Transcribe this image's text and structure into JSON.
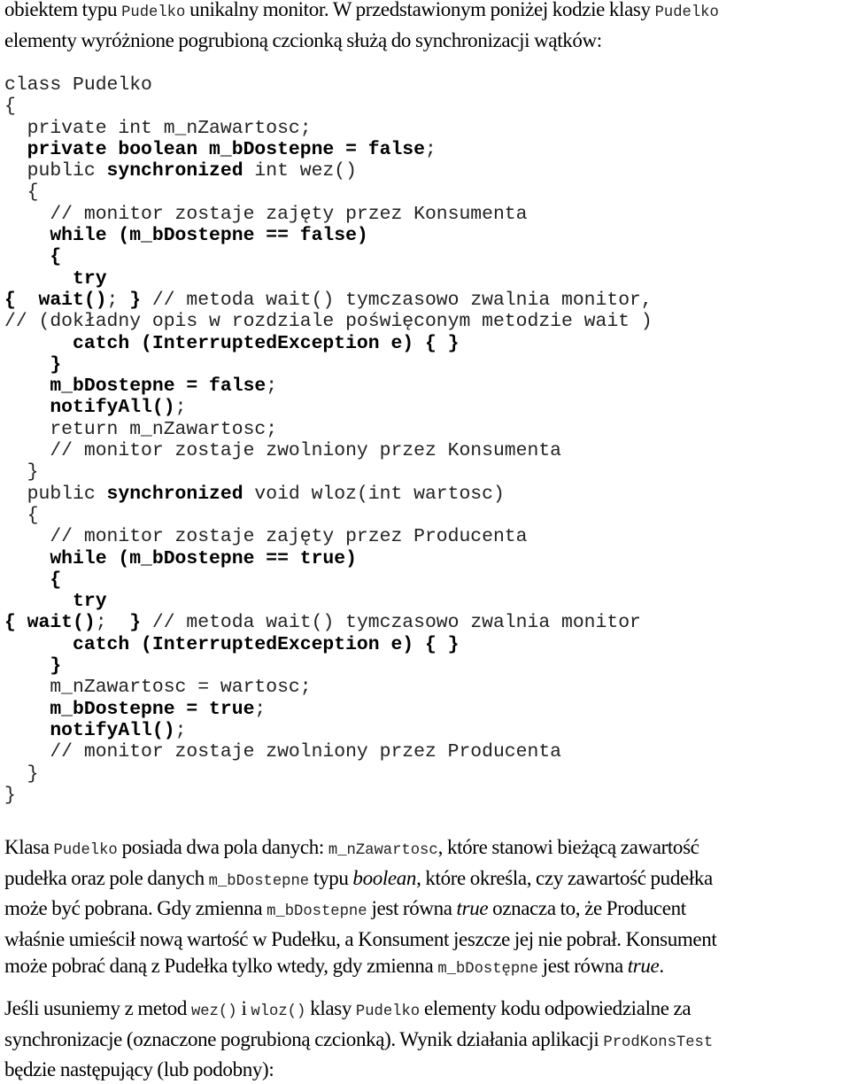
{
  "intro": {
    "line1": [
      {
        "t": "text",
        "v": "obiektem typu "
      },
      {
        "t": "code",
        "v": "Pudelko"
      },
      {
        "t": "text",
        "v": " unikalny monitor. W przedstawionym poniżej kodzie klasy "
      },
      {
        "t": "code",
        "v": "Pudelko"
      }
    ],
    "line2": [
      {
        "t": "text",
        "v": "elementy wyróżnione pogrubioną czcionką służą do synchronizacji wątków:"
      }
    ]
  },
  "code_lines": [
    [
      {
        "t": "n",
        "v": "class Pudelko"
      }
    ],
    [
      {
        "t": "n",
        "v": "{"
      }
    ],
    [
      {
        "t": "n",
        "v": "  private int m_nZawartosc;"
      }
    ],
    [
      {
        "t": "b",
        "v": "  private boolean m_bDostepne = false"
      },
      {
        "t": "n",
        "v": ";"
      }
    ],
    [
      {
        "t": "n",
        "v": "  public "
      },
      {
        "t": "b",
        "v": "synchronized"
      },
      {
        "t": "n",
        "v": " int wez()"
      }
    ],
    [
      {
        "t": "n",
        "v": "  {"
      }
    ],
    [
      {
        "t": "n",
        "v": "    // monitor zostaje zajęty przez Konsumenta"
      }
    ],
    [
      {
        "t": "b",
        "v": "    while (m_bDostepne == false)"
      }
    ],
    [
      {
        "t": "b",
        "v": "    {"
      }
    ],
    [
      {
        "t": "b",
        "v": "      try"
      }
    ],
    [
      {
        "t": "b",
        "v": "{  wait()"
      },
      {
        "t": "n",
        "v": "; "
      },
      {
        "t": "b",
        "v": "}"
      },
      {
        "t": "n",
        "v": " // metoda wait() tymczasowo zwalnia monitor,"
      }
    ],
    [
      {
        "t": "n",
        "v": "// (dokładny opis w rozdziale poświęconym metodzie wait )"
      }
    ],
    [
      {
        "t": "b",
        "v": "      catch (InterruptedException e) { }"
      }
    ],
    [
      {
        "t": "b",
        "v": "    }"
      }
    ],
    [
      {
        "t": "b",
        "v": "    m_bDostepne = false"
      },
      {
        "t": "n",
        "v": ";"
      }
    ],
    [
      {
        "t": "b",
        "v": "    notifyAll()"
      },
      {
        "t": "n",
        "v": ";"
      }
    ],
    [
      {
        "t": "n",
        "v": "    return m_nZawartosc;"
      }
    ],
    [
      {
        "t": "n",
        "v": "    // monitor zostaje zwolniony przez Konsumenta"
      }
    ],
    [
      {
        "t": "n",
        "v": "  }"
      }
    ],
    [
      {
        "t": "n",
        "v": "  public "
      },
      {
        "t": "b",
        "v": "synchronized"
      },
      {
        "t": "n",
        "v": " void wloz(int wartosc)"
      }
    ],
    [
      {
        "t": "n",
        "v": "  {"
      }
    ],
    [
      {
        "t": "n",
        "v": "    // monitor zostaje zajęty przez Producenta"
      }
    ],
    [
      {
        "t": "b",
        "v": "    while (m_bDostepne == true)"
      }
    ],
    [
      {
        "t": "b",
        "v": "    {"
      }
    ],
    [
      {
        "t": "b",
        "v": "      try"
      }
    ],
    [
      {
        "t": "b",
        "v": "{ wait()"
      },
      {
        "t": "n",
        "v": ";  "
      },
      {
        "t": "b",
        "v": "}"
      },
      {
        "t": "n",
        "v": " // metoda wait() tymczasowo zwalnia monitor"
      }
    ],
    [
      {
        "t": "b",
        "v": "      catch (InterruptedException e) { }"
      }
    ],
    [
      {
        "t": "b",
        "v": "    }"
      }
    ],
    [
      {
        "t": "n",
        "v": "    m_nZawartosc = wartosc;"
      }
    ],
    [
      {
        "t": "b",
        "v": "    m_bDostepne = true"
      },
      {
        "t": "n",
        "v": ";"
      }
    ],
    [
      {
        "t": "b",
        "v": "    notifyAll()"
      },
      {
        "t": "n",
        "v": ";"
      }
    ],
    [
      {
        "t": "n",
        "v": "    // monitor zostaje zwolniony przez Producenta"
      }
    ],
    [
      {
        "t": "n",
        "v": "  }"
      }
    ],
    [
      {
        "t": "n",
        "v": "}"
      }
    ]
  ],
  "para1": [
    [
      {
        "t": "text",
        "v": "Klasa "
      },
      {
        "t": "code",
        "v": "Pudelko"
      },
      {
        "t": "text",
        "v": " posiada dwa pola danych: "
      },
      {
        "t": "code",
        "v": "m_nZawartosc"
      },
      {
        "t": "text",
        "v": ", które stanowi bieżącą zawartość"
      }
    ],
    [
      {
        "t": "text",
        "v": "pudełka oraz pole danych "
      },
      {
        "t": "code",
        "v": "m_bDostepne"
      },
      {
        "t": "text",
        "v": " typu "
      },
      {
        "t": "em",
        "v": "boolean"
      },
      {
        "t": "text",
        "v": ", które określa, czy zawartość pudełka"
      }
    ],
    [
      {
        "t": "text",
        "v": "może być pobrana. Gdy zmienna "
      },
      {
        "t": "code",
        "v": "m_bDostepne"
      },
      {
        "t": "text",
        "v": " jest równa "
      },
      {
        "t": "em",
        "v": "true"
      },
      {
        "t": "text",
        "v": " oznacza to, że Producent"
      }
    ],
    [
      {
        "t": "text",
        "v": "właśnie umieścił nową wartość w Pudełku, a Konsument jeszcze jej nie pobrał. Konsument"
      }
    ],
    [
      {
        "t": "text",
        "v": "może pobrać daną z Pudełka tylko wtedy, gdy zmienna "
      },
      {
        "t": "code",
        "v": "m_bDostępne"
      },
      {
        "t": "text",
        "v": " jest równa "
      },
      {
        "t": "em",
        "v": "true"
      },
      {
        "t": "text",
        "v": "."
      }
    ]
  ],
  "para2": [
    [
      {
        "t": "text",
        "v": "Jeśli usuniemy z metod "
      },
      {
        "t": "code",
        "v": "wez()"
      },
      {
        "t": "text",
        "v": " i "
      },
      {
        "t": "code",
        "v": "wloz()"
      },
      {
        "t": "text",
        "v": " klasy "
      },
      {
        "t": "code",
        "v": "Pudelko"
      },
      {
        "t": "text",
        "v": " elementy kodu odpowiedzialne za"
      }
    ],
    [
      {
        "t": "text",
        "v": "synchronizacje (oznaczone pogrubioną czcionką). Wynik działania aplikacji "
      },
      {
        "t": "code",
        "v": "ProdKonsTest"
      }
    ],
    [
      {
        "t": "text",
        "v": "będzie następujący (lub podobny):"
      }
    ]
  ]
}
